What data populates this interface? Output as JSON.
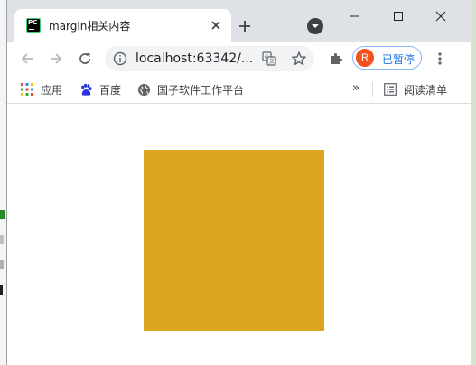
{
  "tab": {
    "favicon_text": "PC",
    "title": "margin相关内容",
    "close_glyph": "✕"
  },
  "window_controls": {
    "minimize_icon": "minimize-icon",
    "maximize_icon": "maximize-icon",
    "close_icon": "close-icon"
  },
  "toolbar": {
    "url": "localhost:63342/...",
    "profile_initial": "R",
    "profile_label": "已暂停"
  },
  "bookmarks": {
    "items": [
      {
        "label": "应用",
        "icon": "apps-grid-icon"
      },
      {
        "label": "百度",
        "icon": "baidu-paw-icon"
      },
      {
        "label": "国子软件工作平台",
        "icon": "globe-icon"
      }
    ],
    "overflow_glyph": "»",
    "reading_list_label": "阅读清单"
  },
  "page": {
    "box_color": "#daa520"
  },
  "colors": {
    "tabstrip_bg": "#dee1e6",
    "accent_blue": "#1a73e8",
    "profile_avatar": "#f4511e"
  }
}
